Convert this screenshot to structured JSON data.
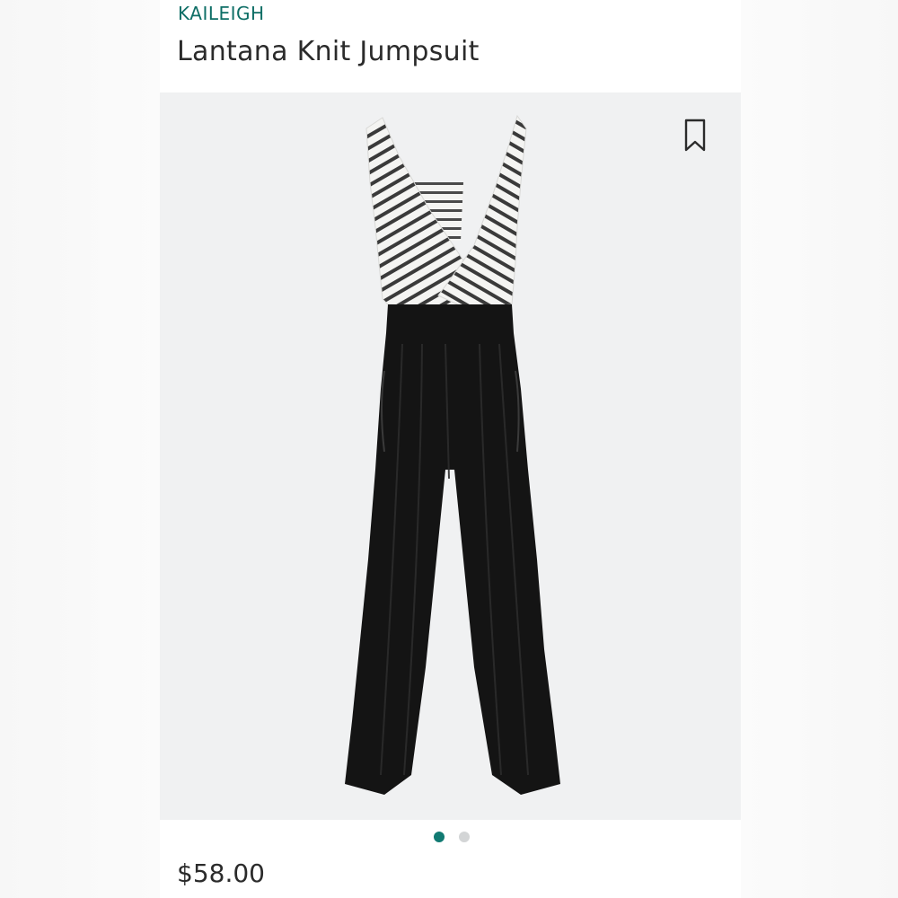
{
  "product": {
    "brand": "KAILEIGH",
    "name": "Lantana Knit Jumpsuit",
    "price": "$58.00"
  },
  "image": {
    "carousel_count": 2,
    "active_index": 0,
    "bookmark_icon": "bookmark-icon",
    "garment_description_icon": "jumpsuit-image"
  },
  "colors": {
    "brand_accent": "#0e6e66",
    "active_dot": "#117a72",
    "inactive_dot": "#d3d5d6",
    "image_background": "#f0f1f2"
  }
}
